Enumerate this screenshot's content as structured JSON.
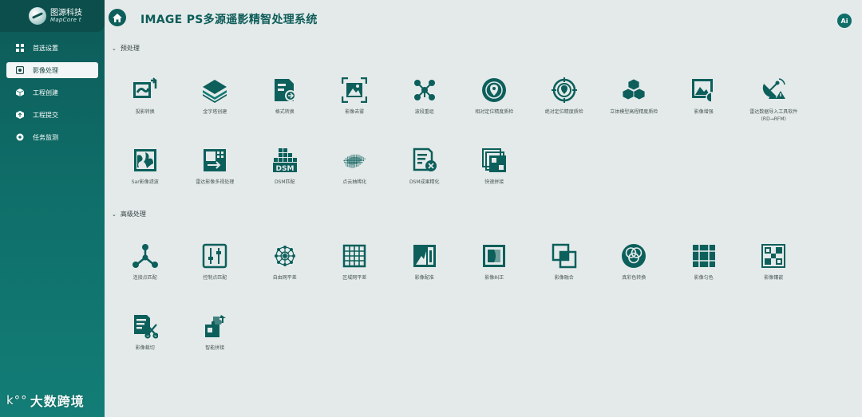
{
  "brand": {
    "name_cn": "图源科技",
    "name_en": "MapCore t"
  },
  "sidebar": {
    "items": [
      {
        "label": "首选设置",
        "icon": "grid-icon",
        "active": false
      },
      {
        "label": "影像处理",
        "icon": "image-process-icon",
        "active": true
      },
      {
        "label": "工程创建",
        "icon": "cube-icon",
        "active": false
      },
      {
        "label": "工程提交",
        "icon": "upload-cube-icon",
        "active": false
      },
      {
        "label": "任务监测",
        "icon": "monitor-gear-icon",
        "active": false
      }
    ]
  },
  "header": {
    "title": "IMAGE PS多源遥影精智处理系统",
    "ai_label": "Ai"
  },
  "watermark": {
    "logo": "k°°",
    "text": "大数跨境"
  },
  "sections": [
    {
      "title": "预处理",
      "tools": [
        {
          "label": "投影转换",
          "icon": "projection-transform-icon"
        },
        {
          "label": "金字塔创建",
          "icon": "pyramid-icon"
        },
        {
          "label": "格式转换",
          "icon": "format-convert-icon"
        },
        {
          "label": "影像去雾",
          "icon": "dehaze-icon"
        },
        {
          "label": "波段重组",
          "icon": "band-regroup-icon"
        },
        {
          "label": "相对定位精度质检",
          "icon": "relative-accuracy-icon"
        },
        {
          "label": "绝对定位精度质检",
          "icon": "absolute-accuracy-icon"
        },
        {
          "label": "立体模型高程精度质检",
          "icon": "stereo-cubes-icon"
        },
        {
          "label": "影像增强",
          "icon": "image-enhance-icon"
        },
        {
          "label": "雷达数据导入工具软件\n(RD→RFM)",
          "icon": "radar-import-icon"
        },
        {
          "label": "Sar影像滤波",
          "icon": "sar-filter-icon"
        },
        {
          "label": "雷达影像多视处理",
          "icon": "radar-multilook-icon"
        },
        {
          "label": "DSM匹配",
          "icon": "dsm-icon"
        },
        {
          "label": "点云抽稀化",
          "icon": "point-cloud-icon"
        },
        {
          "label": "DSM成果精化",
          "icon": "dsm-refine-icon"
        },
        {
          "label": "快速拼接",
          "icon": "fast-mosaic-icon"
        }
      ]
    },
    {
      "title": "高级处理",
      "tools": [
        {
          "label": "连接点匹配",
          "icon": "tie-point-icon"
        },
        {
          "label": "控制点匹配",
          "icon": "control-point-icon"
        },
        {
          "label": "自由网平差",
          "icon": "free-network-icon"
        },
        {
          "label": "区域网平差",
          "icon": "block-adjust-icon"
        },
        {
          "label": "影像配准",
          "icon": "registration-icon"
        },
        {
          "label": "影像纠正",
          "icon": "rectify-icon"
        },
        {
          "label": "影像融合",
          "icon": "fusion-icon"
        },
        {
          "label": "真彩色转换",
          "icon": "true-color-icon"
        },
        {
          "label": "影像匀色",
          "icon": "color-balance-icon"
        },
        {
          "label": "影像镶嵌",
          "icon": "mosaic-icon"
        },
        {
          "label": "影像裁切",
          "icon": "clip-icon"
        },
        {
          "label": "智能拼接",
          "icon": "smart-mosaic-icon"
        }
      ]
    }
  ],
  "colors": {
    "primary": "#0c5f5b",
    "sidebar_top": "#0c5a57",
    "background": "#e4eaea"
  }
}
